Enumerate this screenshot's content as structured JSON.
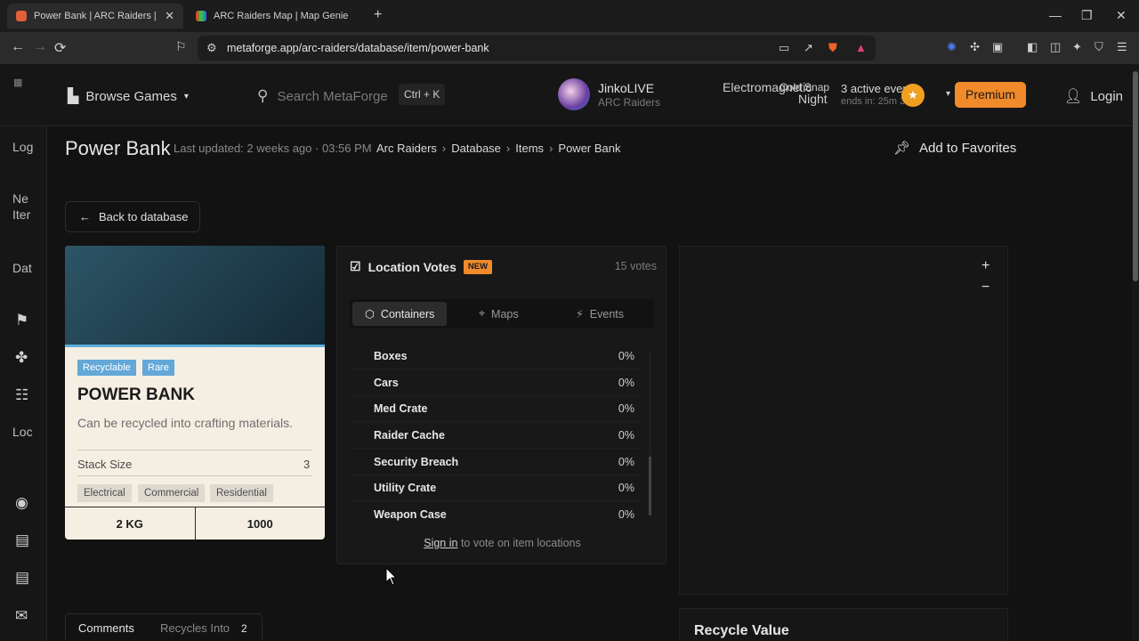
{
  "browser": {
    "tabs": [
      {
        "title": "Power Bank | ARC Raiders | MetaForge",
        "close": "✕"
      },
      {
        "title": "ARC Raiders Map | Map Genie"
      }
    ],
    "new_tab": "+",
    "window_controls": [
      "—",
      "❐",
      "✕"
    ],
    "url": "metaforge.app/arc-raiders/database/item/power-bank",
    "nav": {
      "back": "←",
      "forward": "→",
      "reload": "⟳"
    }
  },
  "site_header": {
    "browse_label": "Browse Games",
    "search_placeholder": "Search MetaForge",
    "search_shortcut": "Ctrl + K",
    "streamer": {
      "name": "JinkoLIVE",
      "game": "ARC Raiders"
    },
    "broken_images": [
      "Electromagnetic",
      "Cold Snap",
      "Night"
    ],
    "events": {
      "title": "3 active events",
      "subtitle": "ends in: 25m 3"
    },
    "premium_label": "Premium",
    "login_label": "Login"
  },
  "left_rail": {
    "items": [
      {
        "label": "Log",
        "kind": "broken-image"
      },
      {
        "label": "Ne\nIter",
        "kind": "broken-image"
      },
      {
        "label": "Dat",
        "kind": "broken-image"
      },
      {
        "label": "Loc",
        "kind": "broken-image"
      }
    ]
  },
  "page": {
    "title": "Power Bank",
    "last_updated": "Last updated: 2 weeks ago · 03:56 PM",
    "breadcrumbs": [
      "Arc Raiders",
      "Database",
      "Items",
      "Power Bank"
    ],
    "add_favorites": "Add to Favorites",
    "back_label": "Back to database"
  },
  "item_card": {
    "badges": [
      "Recyclable",
      "Rare"
    ],
    "name": "POWER BANK",
    "description": "Can be recycled into crafting materials.",
    "stack_size_label": "Stack Size",
    "stack_size_value": "3",
    "tags": [
      "Electrical",
      "Commercial",
      "Residential"
    ],
    "weight": "2 KG",
    "value": "1000",
    "accent_color": "#5bb0d8"
  },
  "location_votes": {
    "title": "Location Votes",
    "new_badge": "NEW",
    "votes": "15 votes",
    "tabs": [
      "Containers",
      "Maps",
      "Events"
    ],
    "active_tab": "Containers",
    "rows": [
      {
        "name": "Boxes",
        "pct": "0%"
      },
      {
        "name": "Cars",
        "pct": "0%"
      },
      {
        "name": "Med Crate",
        "pct": "0%"
      },
      {
        "name": "Raider Cache",
        "pct": "0%"
      },
      {
        "name": "Security Breach",
        "pct": "0%"
      },
      {
        "name": "Utility Crate",
        "pct": "0%"
      },
      {
        "name": "Weapon Case",
        "pct": "0%"
      }
    ],
    "sign_in_link": "Sign in",
    "sign_in_rest": " to vote on item locations"
  },
  "map_panel": {
    "zoom_in": "+",
    "zoom_out": "−"
  },
  "recycle_value": {
    "title": "Recycle Value"
  },
  "bottom_tabs": {
    "comments": "Comments",
    "recycles_into": "Recycles Into",
    "recycles_count": "2"
  },
  "colors": {
    "accent": "#f08a2a",
    "background": "#121212"
  }
}
